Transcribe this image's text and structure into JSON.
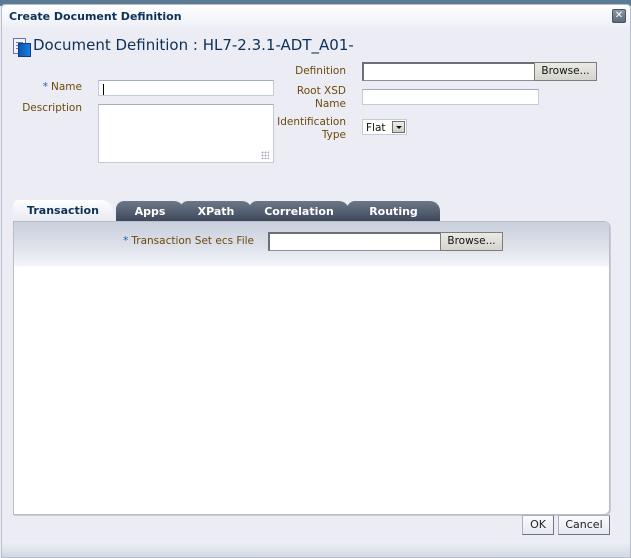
{
  "dialog": {
    "title": "Create Document Definition",
    "close_icon": "close-icon",
    "header_icon": "document-definition-icon",
    "header": "Document Definition : HL7-2.3.1-ADT_A01-"
  },
  "form": {
    "required_marker": "*",
    "name_label": "Name",
    "name_value": "",
    "description_label": "Description",
    "description_value": "",
    "definition_label": "Definition",
    "definition_value": "",
    "browse_label": "Browse...",
    "root_xsd_label_1": "Root XSD",
    "root_xsd_label_2": "Name",
    "root_xsd_value": "",
    "identification_label_1": "Identification",
    "identification_label_2": "Type",
    "identification_value": "Flat"
  },
  "tabs": [
    {
      "label": "Transaction",
      "active": true
    },
    {
      "label": "Apps",
      "active": false
    },
    {
      "label": "XPath",
      "active": false
    },
    {
      "label": "Correlation",
      "active": false
    },
    {
      "label": "Routing",
      "active": false
    }
  ],
  "transaction": {
    "ecs_label": "Transaction Set ecs File",
    "ecs_value": "",
    "browse_label": "Browse..."
  },
  "footer": {
    "ok_label": "OK",
    "cancel_label": "Cancel"
  }
}
